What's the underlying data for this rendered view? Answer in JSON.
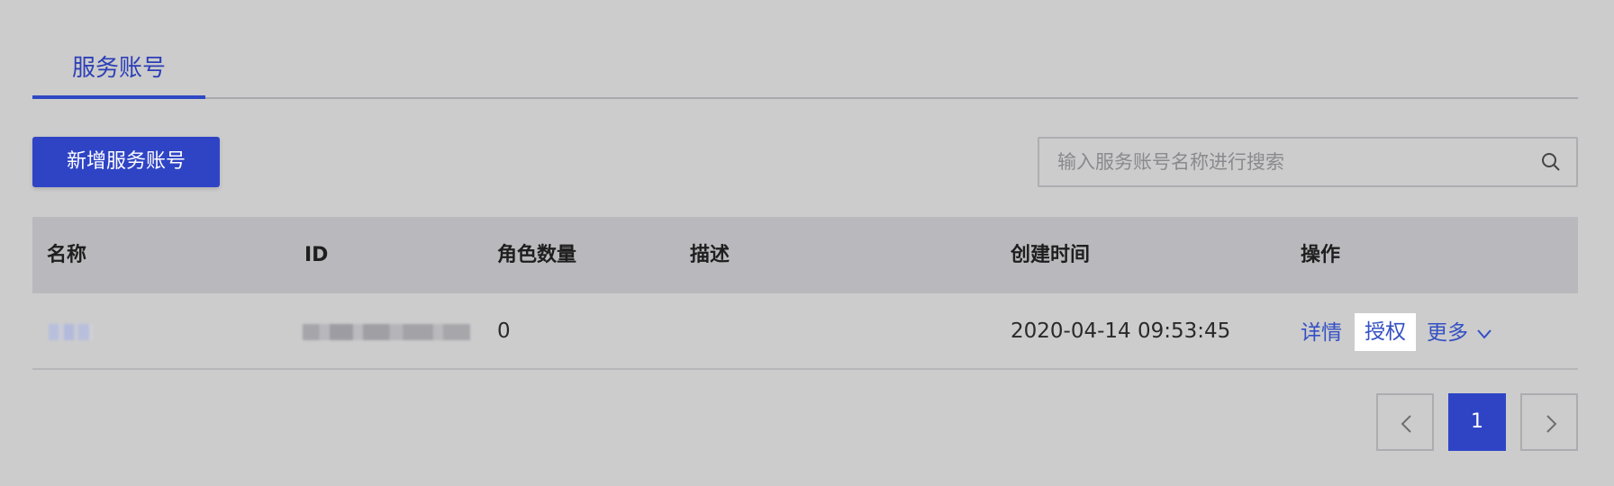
{
  "tabs": {
    "active_label": "服务账号"
  },
  "toolbar": {
    "add_label": "新增服务账号"
  },
  "search": {
    "placeholder": "输入服务账号名称进行搜索"
  },
  "table": {
    "headers": {
      "name": "名称",
      "id": "ID",
      "role_count": "角色数量",
      "description": "描述",
      "created_at": "创建时间",
      "actions": "操作"
    },
    "rows": [
      {
        "name": "",
        "id": "",
        "role_count": "0",
        "description": "",
        "created_at": "2020-04-14 09:53:45",
        "actions": {
          "detail": "详情",
          "authorize": "授权",
          "more": "更多"
        }
      }
    ]
  },
  "pagination": {
    "current": "1"
  },
  "colors": {
    "accent": "#2f44c5",
    "link": "#3450c4",
    "background": "#cccccc",
    "header_bg": "#b9b9bd"
  }
}
